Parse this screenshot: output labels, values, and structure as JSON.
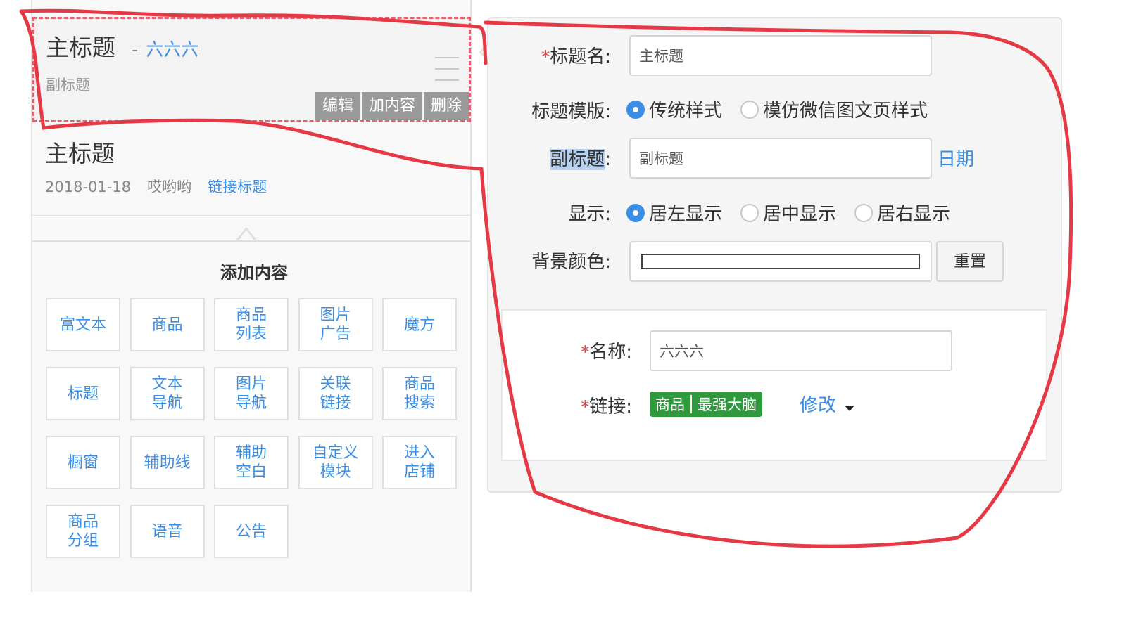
{
  "preview": {
    "block1": {
      "title": "主标题",
      "dash": "-",
      "link_text": "六六六",
      "subtitle": "副标题",
      "actions": [
        "编辑",
        "加内容",
        "删除"
      ]
    },
    "block2": {
      "title": "主标题",
      "date": "2018-01-18",
      "author": "哎哟哟",
      "link_title": "链接标题"
    },
    "add_content": {
      "heading": "添加内容",
      "tiles": [
        [
          "富文本"
        ],
        [
          "商品"
        ],
        [
          "商品",
          "列表"
        ],
        [
          "图片",
          "广告"
        ],
        [
          "魔方"
        ],
        [
          "标题"
        ],
        [
          "文本",
          "导航"
        ],
        [
          "图片",
          "导航"
        ],
        [
          "关联",
          "链接"
        ],
        [
          "商品",
          "搜索"
        ],
        [
          "橱窗"
        ],
        [
          "辅助线"
        ],
        [
          "辅助",
          "空白"
        ],
        [
          "自定义",
          "模块"
        ],
        [
          "进入",
          "店铺"
        ],
        [
          "商品",
          "分组"
        ],
        [
          "语音"
        ],
        [
          "公告"
        ]
      ]
    }
  },
  "form": {
    "title_name": {
      "required_mark": "*",
      "label": "标题名:",
      "value": "主标题"
    },
    "template": {
      "label": "标题模版:",
      "options": [
        "传统样式",
        "模仿微信图文页样式"
      ],
      "selected": 0
    },
    "subtitle": {
      "label_text": "副标题",
      "label_colon": ":",
      "value": "副标题",
      "date_link": "日期"
    },
    "display": {
      "label": "显示:",
      "options": [
        "居左显示",
        "居中显示",
        "居右显示"
      ],
      "selected": 0
    },
    "bg_color": {
      "label": "背景颜色:",
      "value": "#ffffff",
      "reset_label": "重置"
    },
    "sub_item": {
      "name": {
        "required_mark": "*",
        "label": "名称:",
        "value": "六六六"
      },
      "link": {
        "required_mark": "*",
        "label": "链接:",
        "tag_type": "商品",
        "tag_value": "最强大脑",
        "modify_label": "修改"
      }
    }
  },
  "colors": {
    "accent": "#3a8ee6",
    "required": "#e03c3c",
    "tag_green": "#2e9a3d",
    "annotation_red": "#e63946",
    "dashed_border": "#e8606d"
  }
}
